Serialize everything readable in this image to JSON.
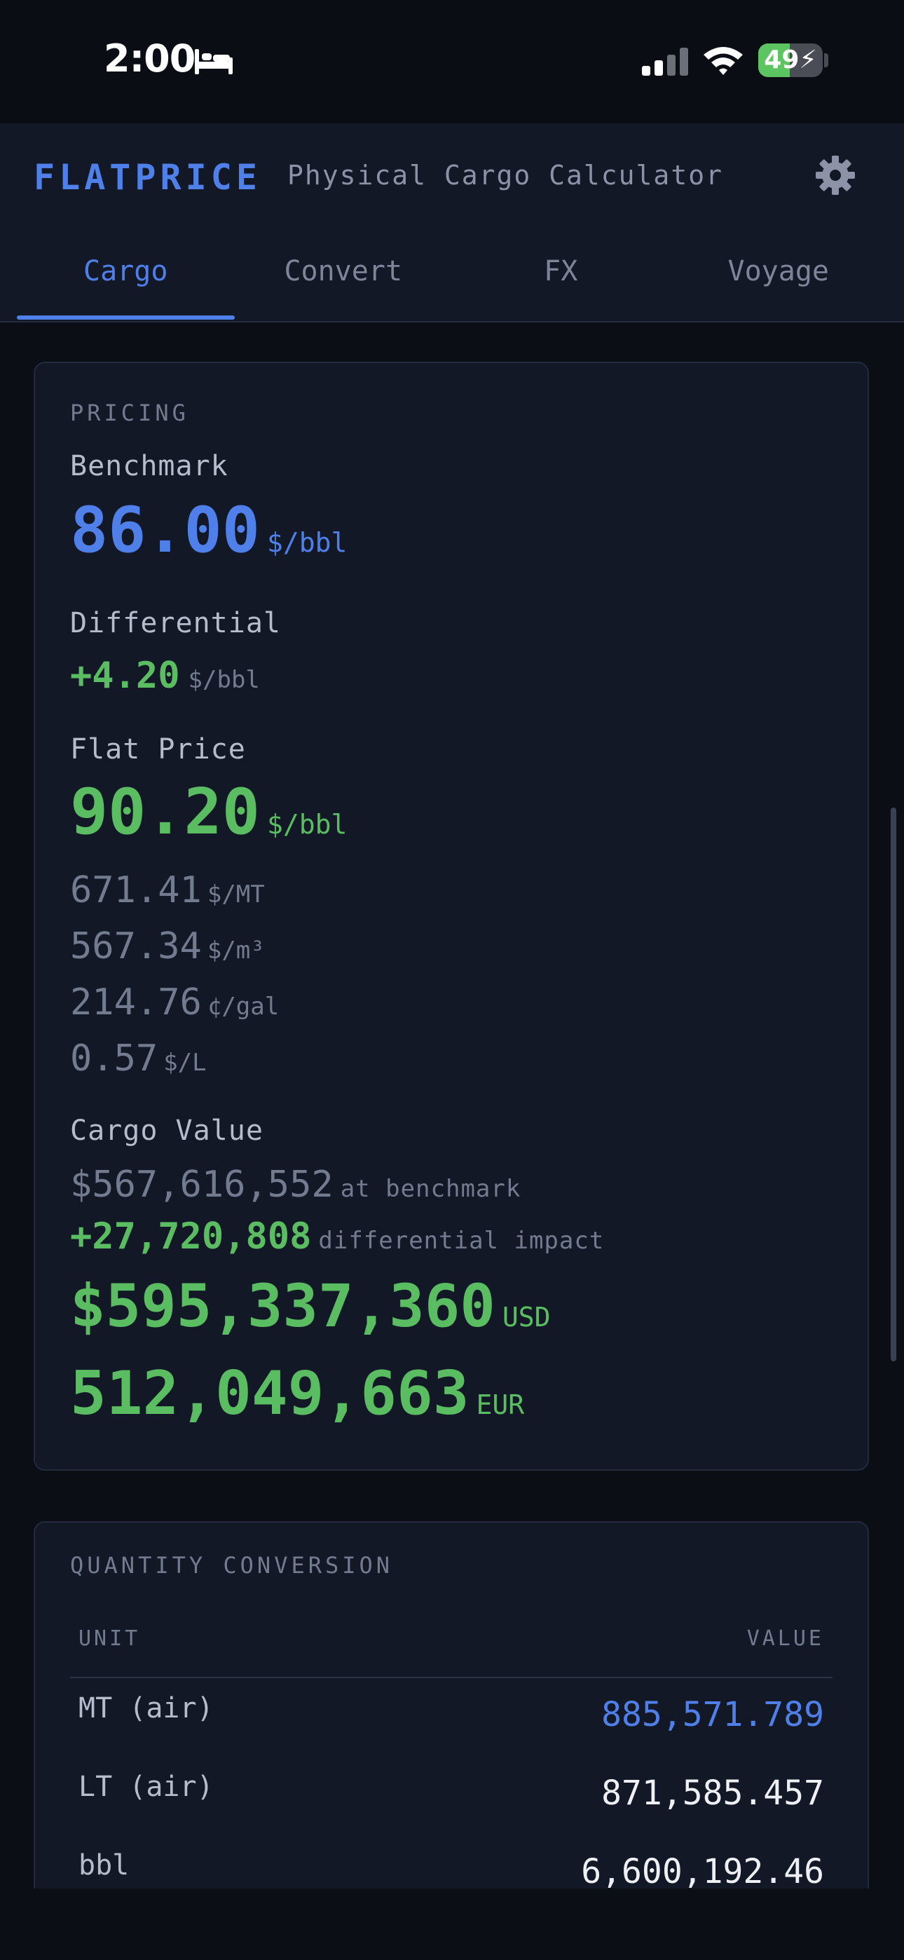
{
  "status_bar": {
    "time": "2:00",
    "battery_level": "49",
    "battery_fraction": 0.49,
    "icons": [
      "bed-icon",
      "signal-icon",
      "wifi-icon",
      "charging-bolt-icon"
    ]
  },
  "header": {
    "brand": "FLATPRICE",
    "subtitle": "Physical Cargo Calculator",
    "settings_icon": "gear-icon"
  },
  "tabs": [
    {
      "label": "Cargo",
      "active": true
    },
    {
      "label": "Convert",
      "active": false
    },
    {
      "label": "FX",
      "active": false
    },
    {
      "label": "Voyage",
      "active": false
    }
  ],
  "pricing": {
    "section_title": "PRICING",
    "benchmark_label": "Benchmark",
    "benchmark_value": "86.00",
    "benchmark_unit": "$/bbl",
    "differential_label": "Differential",
    "differential_value": "+4.20",
    "differential_unit": "$/bbl",
    "flat_price_label": "Flat Price",
    "flat_price_value": "90.20",
    "flat_price_unit": "$/bbl",
    "conversions": [
      {
        "value": "671.41",
        "unit": "$/MT"
      },
      {
        "value": "567.34",
        "unit": "$/m³"
      },
      {
        "value": "214.76",
        "unit": "¢/gal"
      },
      {
        "value": "0.57",
        "unit": "$/L"
      }
    ],
    "cargo_value_label": "Cargo Value",
    "at_benchmark_value": "$567,616,552",
    "at_benchmark_note": "at benchmark",
    "differential_impact_value": "+27,720,808",
    "differential_impact_note": "differential impact",
    "total_usd_value": "$595,337,360",
    "total_usd_unit": "USD",
    "total_eur_value": "512,049,663",
    "total_eur_unit": "EUR"
  },
  "quantity_conversion": {
    "section_title": "QUANTITY CONVERSION",
    "col_unit": "UNIT",
    "col_value": "VALUE",
    "rows": [
      {
        "unit": "MT (air)",
        "value": "885,571.789"
      },
      {
        "unit": "LT (air)",
        "value": "871,585.457"
      },
      {
        "unit": "bbl",
        "value": "6,600,192.46"
      }
    ]
  },
  "colors": {
    "accent_blue": "#4f80ea",
    "accent_green": "#5bbd62",
    "card_bg": "#131827",
    "page_bg": "#0b0e15"
  }
}
